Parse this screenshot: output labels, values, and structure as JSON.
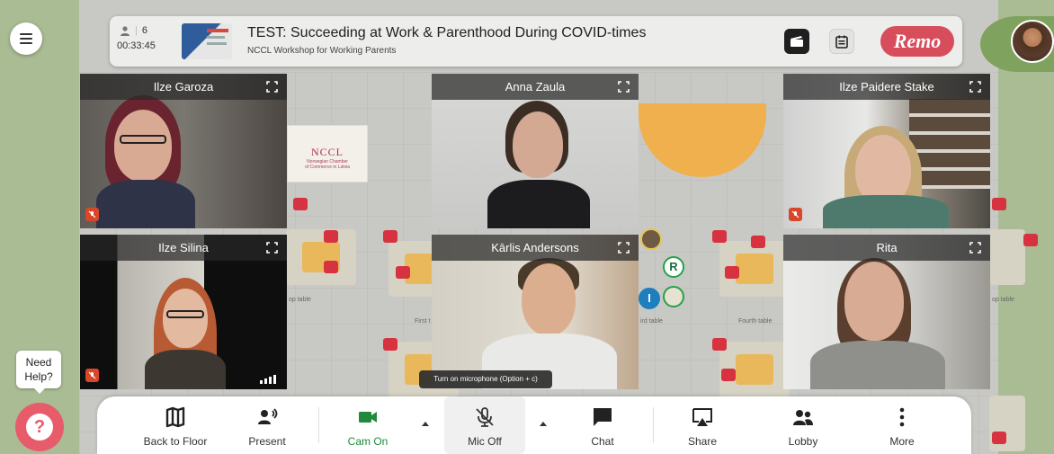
{
  "topbar": {
    "attendee_count": "6",
    "elapsed_time": "00:33:45",
    "event_title": "TEST: Succeeding at Work & Parenthood During COVID-times",
    "event_subtitle": "NCCL Workshop for Working Parents",
    "brand": "Remo"
  },
  "floor": {
    "sign_name": "NCCL",
    "sign_sub1": "Norwegian Chamber",
    "sign_sub2": "of Commerce in Latvia",
    "table_labels": [
      "op table",
      "First t",
      "ird table",
      "Fourth table",
      "op table"
    ],
    "avatar_badges": [
      "R",
      "I"
    ]
  },
  "tiles": [
    {
      "name": "Ilze Garoza",
      "muted": true
    },
    {
      "name": "Anna Zaula",
      "muted": false
    },
    {
      "name": "Ilze Paidere Stake",
      "muted": true
    },
    {
      "name": "Ilze Silina",
      "muted": true
    },
    {
      "name": "Kārlis Andersons",
      "muted": false
    },
    {
      "name": "Rita",
      "muted": false
    }
  ],
  "tooltip": "Turn on microphone (Option + c)",
  "help": {
    "line1": "Need",
    "line2": "Help?",
    "button": "?"
  },
  "toolbar": {
    "back_to_floor": "Back to Floor",
    "present": "Present",
    "cam_on": "Cam On",
    "mic_off": "Mic Off",
    "chat": "Chat",
    "share": "Share",
    "lobby": "Lobby",
    "more": "More"
  },
  "colors": {
    "accent_green": "#1f8a3b",
    "brand_red": "#d84d5b",
    "mute_red": "#d9472b"
  }
}
